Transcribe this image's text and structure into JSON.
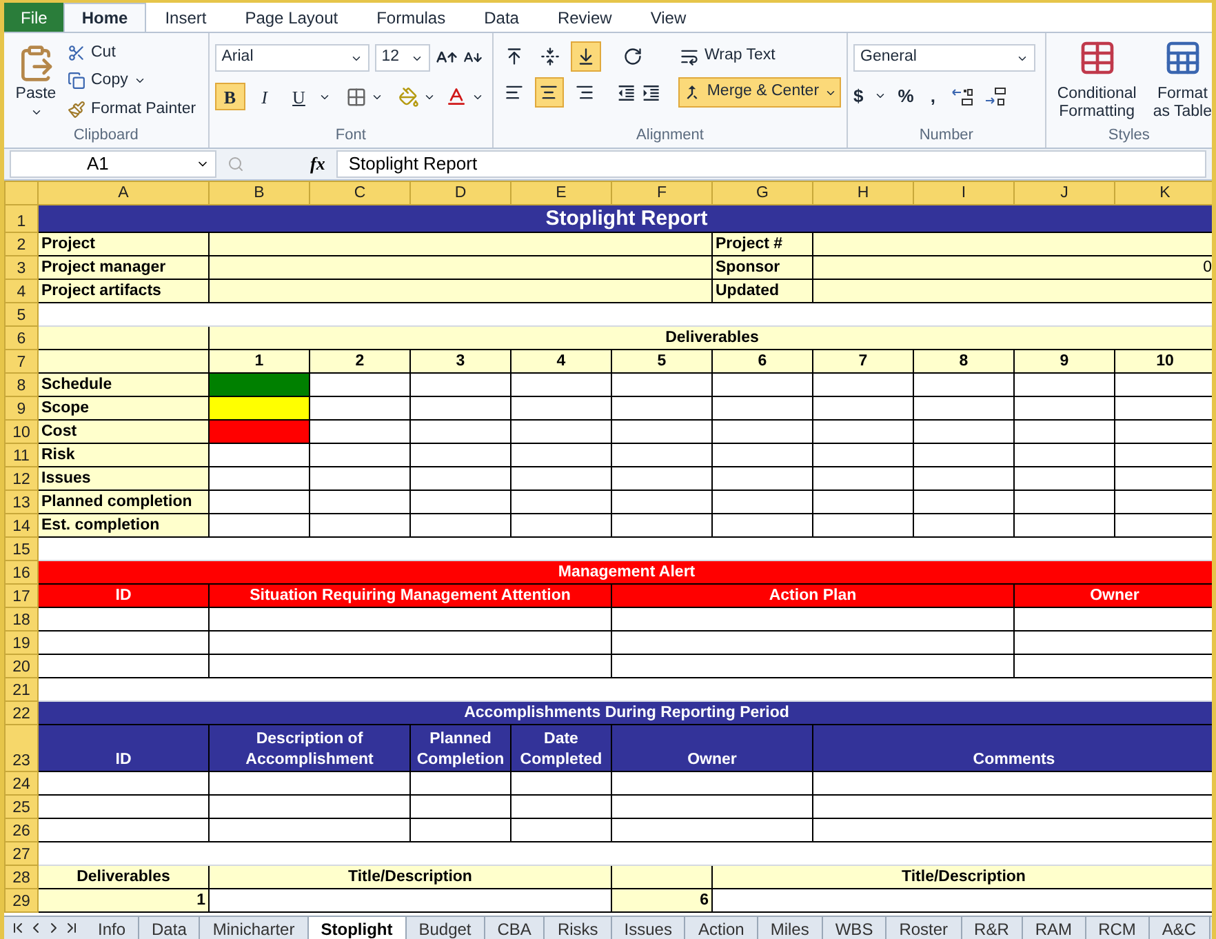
{
  "ribbon_tabs": [
    {
      "label": "File",
      "kind": "file",
      "selected": false
    },
    {
      "label": "Home",
      "kind": "tab",
      "selected": true
    },
    {
      "label": "Insert",
      "kind": "tab",
      "selected": false
    },
    {
      "label": "Page Layout",
      "kind": "tab",
      "selected": false
    },
    {
      "label": "Formulas",
      "kind": "tab",
      "selected": false
    },
    {
      "label": "Data",
      "kind": "tab",
      "selected": false
    },
    {
      "label": "Review",
      "kind": "tab",
      "selected": false
    },
    {
      "label": "View",
      "kind": "tab",
      "selected": false
    }
  ],
  "clipboard": {
    "paste": "Paste",
    "cut": "Cut",
    "copy": "Copy",
    "format_painter": "Format Painter",
    "group": "Clipboard"
  },
  "font": {
    "name": "Arial",
    "size": "12",
    "group": "Font",
    "styles": [
      {
        "label": "B",
        "kind": "bold",
        "on": true
      },
      {
        "label": "I",
        "kind": "italic",
        "on": false
      },
      {
        "label": "U",
        "kind": "underline",
        "on": false
      }
    ]
  },
  "alignment": {
    "group": "Alignment",
    "vertical": [
      {
        "kind": "top",
        "on": false
      },
      {
        "kind": "middle",
        "on": false
      },
      {
        "kind": "bottom",
        "on": true
      }
    ],
    "horizontal": [
      {
        "kind": "left",
        "on": false
      },
      {
        "kind": "center",
        "on": true
      },
      {
        "kind": "right",
        "on": false
      }
    ],
    "wrap_text": {
      "label": "Wrap Text",
      "on": false
    },
    "merge_center": {
      "label": "Merge & Center",
      "on": true
    }
  },
  "number": {
    "format": "General",
    "currency": "$",
    "percent": "%",
    "comma": ",",
    "group": "Number"
  },
  "styles": {
    "conditional": [
      "Conditional",
      "Formatting"
    ],
    "format_table": [
      "Format",
      "as Table"
    ],
    "group": "Styles"
  },
  "formula_bar": {
    "name_box": "A1",
    "fx": "fx",
    "content": "Stoplight Report"
  },
  "columns": [
    "A",
    "B",
    "C",
    "D",
    "E",
    "F",
    "G",
    "H",
    "I",
    "J",
    "K"
  ],
  "row_numbers": [
    "1",
    "2",
    "3",
    "4",
    "5",
    "6",
    "7",
    "8",
    "9",
    "10",
    "11",
    "12",
    "13",
    "14",
    "15",
    "16",
    "17",
    "18",
    "19",
    "20",
    "21",
    "22",
    "23",
    "24",
    "25",
    "26",
    "27",
    "28",
    "29"
  ],
  "title": "Stoplight Report",
  "project_info": [
    {
      "label": "Project",
      "right_label": "Project #"
    },
    {
      "label": "Project manager",
      "right_label": "Sponsor",
      "right_value": "0"
    },
    {
      "label": "Project artifacts",
      "right_label": "Updated"
    }
  ],
  "deliverables": {
    "title": "Deliverables",
    "numbers": [
      "1",
      "2",
      "3",
      "4",
      "5",
      "6",
      "7",
      "8",
      "9",
      "10"
    ],
    "rows": [
      {
        "label": "Schedule",
        "color": "#008000"
      },
      {
        "label": "Scope",
        "color": "#ffff00"
      },
      {
        "label": "Cost",
        "color": "#ff0000"
      },
      {
        "label": "Risk"
      },
      {
        "label": "Issues"
      },
      {
        "label": "Planned completion"
      },
      {
        "label": "Est. completion"
      }
    ]
  },
  "management_alert": {
    "title": "Management Alert",
    "columns": [
      "ID",
      "Situation Requiring Management Attention",
      "Action Plan",
      "Owner"
    ]
  },
  "accomplishments": {
    "title": "Accomplishments During Reporting Period",
    "columns": [
      "ID",
      "Description of Accomplishment",
      "Planned Completion",
      "Date Completed",
      "Owner",
      "Comments"
    ]
  },
  "deliverables_list": {
    "columns": [
      "Deliverables",
      "Title/Description",
      "Title/Description"
    ],
    "first_row": [
      "1",
      "6"
    ]
  },
  "sheet_tabs": [
    {
      "label": "Info",
      "selected": false
    },
    {
      "label": "Data",
      "selected": false
    },
    {
      "label": "Minicharter",
      "selected": false
    },
    {
      "label": "Stoplight",
      "selected": true
    },
    {
      "label": "Budget",
      "selected": false
    },
    {
      "label": "CBA",
      "selected": false
    },
    {
      "label": "Risks",
      "selected": false
    },
    {
      "label": "Issues",
      "selected": false
    },
    {
      "label": "Action",
      "selected": false
    },
    {
      "label": "Miles",
      "selected": false
    },
    {
      "label": "WBS",
      "selected": false
    },
    {
      "label": "Roster",
      "selected": false
    },
    {
      "label": "R&R",
      "selected": false
    },
    {
      "label": "RAM",
      "selected": false
    },
    {
      "label": "RCM",
      "selected": false
    },
    {
      "label": "A&C",
      "selected": false
    }
  ]
}
